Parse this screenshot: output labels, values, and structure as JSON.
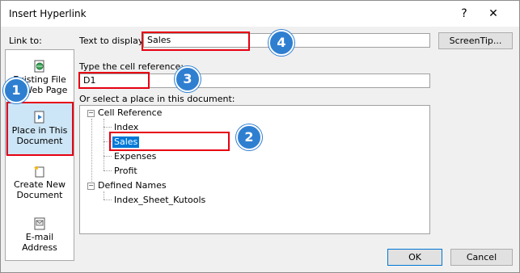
{
  "dialog": {
    "title": "Insert Hyperlink",
    "help_label": "?",
    "close_label": "✕"
  },
  "sidebar": {
    "heading": "Link to:",
    "items": [
      {
        "label_line1": "Existing File",
        "label_line2": "or Web Page",
        "icon": "web-page-icon"
      },
      {
        "label_line1": "Place in This",
        "label_line2": "Document",
        "icon": "document-place-icon",
        "selected": true
      },
      {
        "label_line1": "Create New",
        "label_line2": "Document",
        "icon": "new-document-icon"
      },
      {
        "label_line1": "E-mail",
        "label_line2": "Address",
        "icon": "email-icon"
      }
    ]
  },
  "text_to_display": {
    "label": "Text to display:",
    "value": "Sales"
  },
  "screentip_label": "ScreenTip...",
  "cell_reference": {
    "label": "Type the cell reference:",
    "value": "D1"
  },
  "select_place_label": "Or select a place in this document:",
  "tree": {
    "cell_reference_root": "Cell Reference",
    "sheets": [
      "Index",
      "Sales",
      "Expenses",
      "Profit"
    ],
    "selected_sheet": "Sales",
    "defined_names_root": "Defined Names",
    "names": [
      "Index_Sheet_Kutools"
    ]
  },
  "buttons": {
    "ok": "OK",
    "cancel": "Cancel"
  },
  "callouts": [
    "1",
    "2",
    "3",
    "4"
  ],
  "colors": {
    "highlight_red": "#e60012",
    "callout_blue": "#2f7fd1",
    "selection_blue": "#0078d7"
  }
}
